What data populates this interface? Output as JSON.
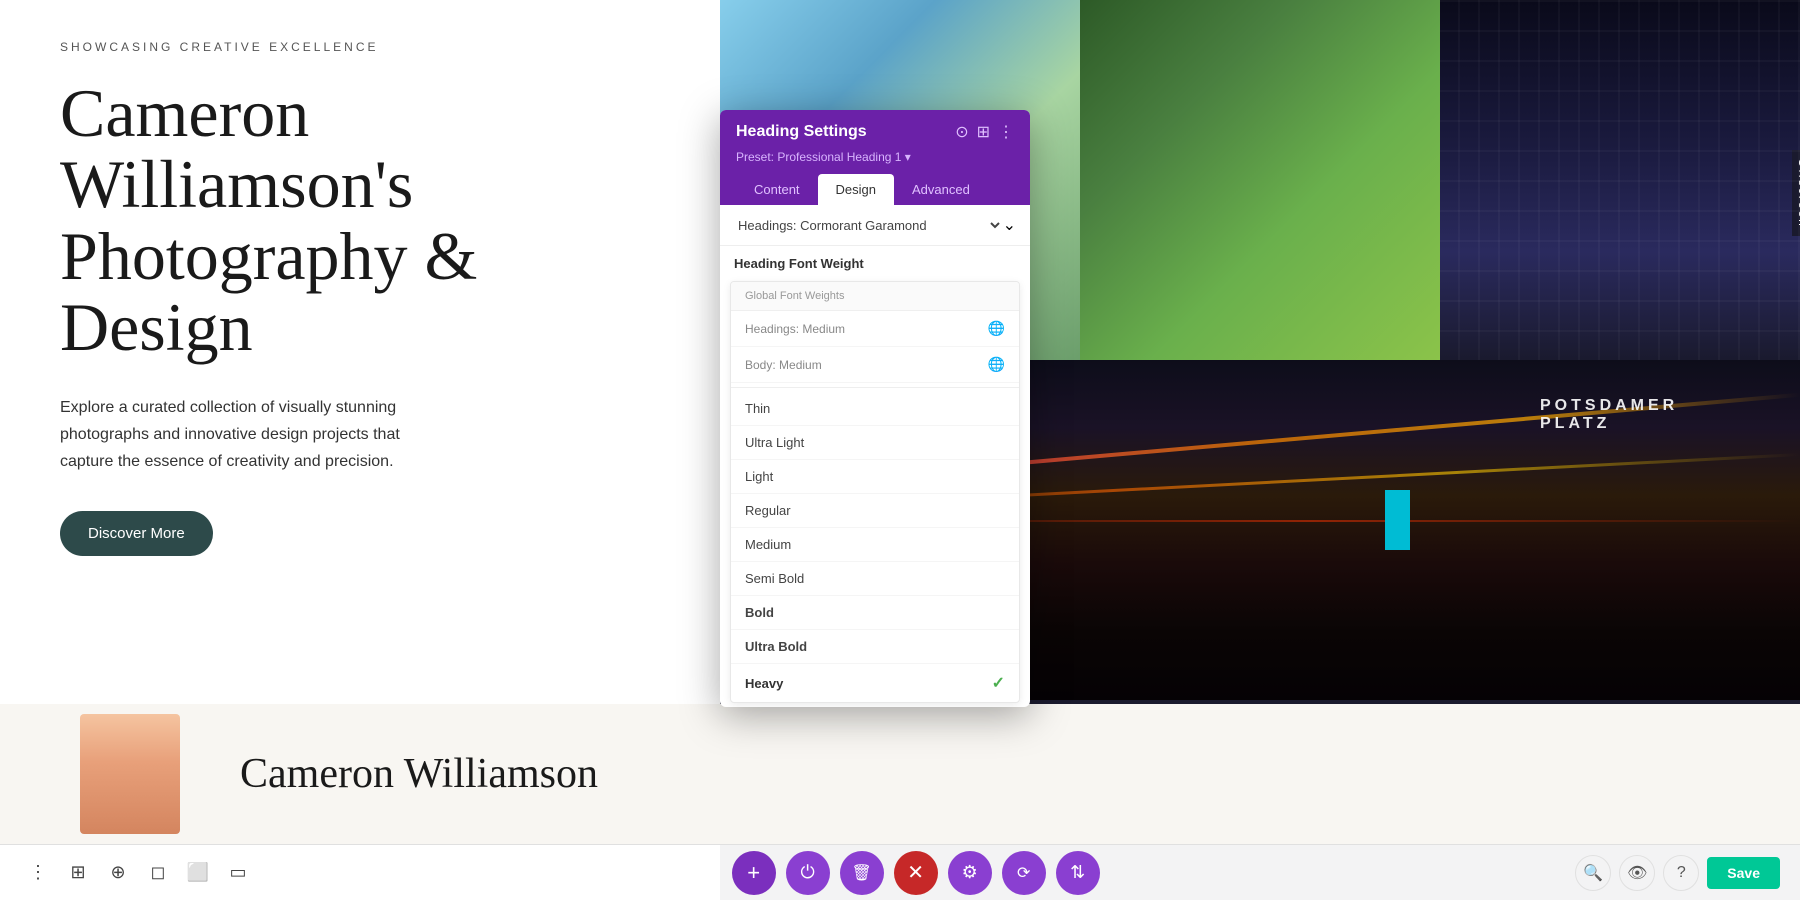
{
  "page": {
    "showcase_label": "SHOWCASING CREATIVE EXCELLENCE",
    "main_heading": "Cameron Williamson's Photography & Design",
    "description": "Explore a curated collection of visually stunning photographs and innovative design projects that capture the essence of creativity and precision.",
    "discover_btn": "Discover More",
    "offscreen_label": "Offscreen"
  },
  "panel": {
    "title": "Heading Settings",
    "preset_label": "Preset: Professional Heading 1 ▾",
    "tabs": [
      {
        "id": "content",
        "label": "Content"
      },
      {
        "id": "design",
        "label": "Design"
      },
      {
        "id": "advanced",
        "label": "Advanced"
      }
    ],
    "active_tab": "design",
    "font_select": {
      "current_value": "Headings: Cormorant Garamond",
      "arrow": "⌄"
    },
    "font_weight_section": "Heading Font Weight",
    "dropdown": {
      "global_label": "Global Font Weights",
      "items": [
        {
          "id": "headings-medium",
          "label": "Headings: Medium",
          "type": "global"
        },
        {
          "id": "body-medium",
          "label": "Body: Medium",
          "type": "global"
        },
        {
          "id": "thin",
          "label": "Thin",
          "type": "weight"
        },
        {
          "id": "ultralight",
          "label": "Ultra Light",
          "type": "weight"
        },
        {
          "id": "light",
          "label": "Light",
          "type": "weight"
        },
        {
          "id": "regular",
          "label": "Regular",
          "type": "weight"
        },
        {
          "id": "medium",
          "label": "Medium",
          "type": "weight"
        },
        {
          "id": "semibold",
          "label": "Semi Bold",
          "type": "weight"
        },
        {
          "id": "bold",
          "label": "Bold",
          "type": "weight",
          "bold": true
        },
        {
          "id": "ultrabold",
          "label": "Ultra Bold",
          "type": "weight",
          "bold": true
        },
        {
          "id": "heavy",
          "label": "Heavy",
          "type": "weight",
          "bold": true,
          "selected": true
        }
      ]
    }
  },
  "toolbar": {
    "left_icons": [
      "⋮",
      "⊞",
      "⊕",
      "◻",
      "⬜"
    ],
    "center_buttons": [
      {
        "id": "add",
        "icon": "+",
        "color": "btn-purple",
        "label": "add"
      },
      {
        "id": "power",
        "icon": "⏻",
        "color": "btn-purple-light",
        "label": "power"
      },
      {
        "id": "delete",
        "icon": "🗑",
        "color": "btn-purple-light",
        "label": "delete"
      },
      {
        "id": "close",
        "icon": "✕",
        "color": "btn-red",
        "label": "close"
      },
      {
        "id": "settings",
        "icon": "⚙",
        "color": "btn-purple-light",
        "label": "settings"
      },
      {
        "id": "history",
        "icon": "⟳",
        "color": "btn-purple-light",
        "label": "history"
      },
      {
        "id": "adjust",
        "icon": "⇅",
        "color": "btn-purple-light",
        "label": "adjust"
      }
    ],
    "right_icons": [
      "🔍",
      "👁",
      "?"
    ],
    "save_label": "Save",
    "save_color": "#00c896"
  },
  "bottom_preview": {
    "heading": "Cameron Williamson"
  },
  "colors": {
    "purple_header": "#6b21a8",
    "check_green": "#4caf50",
    "red_strip": "#e53935",
    "teal_strip": "#00bcd4"
  }
}
